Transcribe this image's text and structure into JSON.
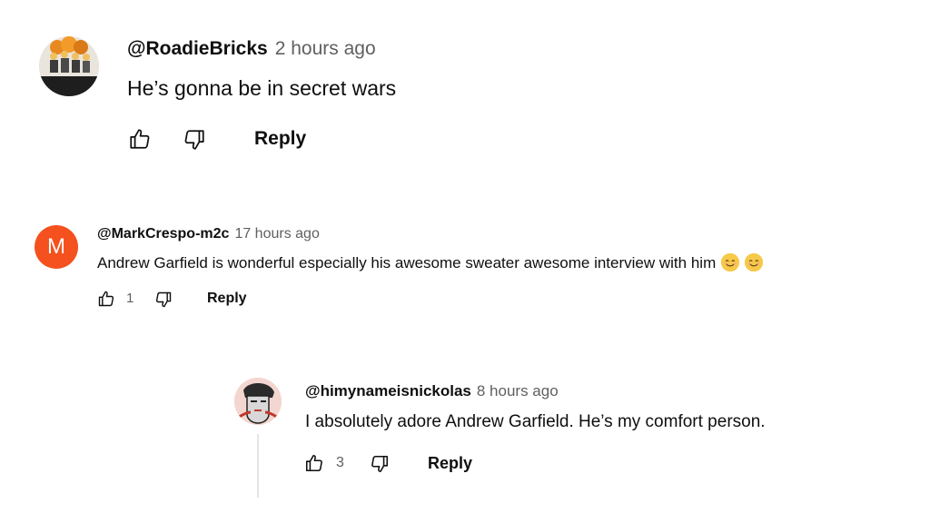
{
  "comments": [
    {
      "author": "@RoadieBricks",
      "time": "2 hours ago",
      "text": "He’s gonna be in secret wars",
      "reply_label": "Reply",
      "like_count": ""
    },
    {
      "author": "@MarkCrespo-m2c",
      "time": "17 hours ago",
      "text": "Andrew Garfield is wonderful especially his awesome sweater awesome interview with him",
      "avatar_letter": "M",
      "avatar_color": "#f4511e",
      "reply_label": "Reply",
      "like_count": "1"
    },
    {
      "author": "@himynameisnickolas",
      "time": "8 hours ago",
      "text": "I absolutely adore Andrew Garfield. He’s my comfort person.",
      "reply_label": "Reply",
      "like_count": "3"
    }
  ],
  "icons": {
    "like": "thumb-up-icon",
    "dislike": "thumb-down-icon",
    "emoji": "smiling-face-emoji"
  }
}
